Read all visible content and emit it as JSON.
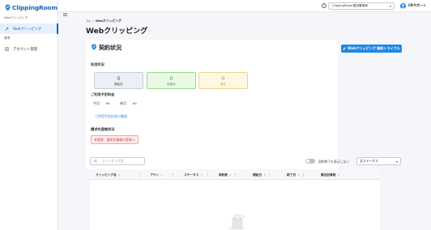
{
  "brand": {
    "name": "ClippingRoom",
    "color": "#1565c0"
  },
  "sidebar": {
    "section1": "Webクリッピング",
    "item_clipping": "Webクリッピング",
    "section2": "管理",
    "item_account": "アカウント管理"
  },
  "header": {
    "company": "ClippingRoom運用事務局",
    "user": "CRサポート",
    "help_icon": "?"
  },
  "breadcrumb": {
    "top": "Top",
    "sep": "/",
    "current": "Webクリッピング"
  },
  "page_title": "Webクリッピング",
  "contract": {
    "title": "契約状況",
    "trial_button": "Webクリッピング 無料トライアル",
    "usage_label": "利用状況",
    "statuses": [
      {
        "count": "0",
        "label": "開始前",
        "color": "#555555"
      },
      {
        "count": "0",
        "label": "利用中",
        "color": "#3a9c2a"
      },
      {
        "count": "0",
        "label": "停止",
        "color": "#c29311"
      }
    ],
    "fee_label": "ご利用予定料金",
    "this_month_label": "今月：",
    "this_month_value": "¥0",
    "next_month_label": "来月：",
    "next_month_value": "¥0",
    "fee_link": "ご利用予定料金の確認",
    "billing_label": "請求先登録状況",
    "billing_status": "未登録",
    "billing_link": "請求先情報の登録へ"
  },
  "filters": {
    "search_placeholder": "クリッピング名",
    "show_ended_label": "契約終了を表示しない",
    "status_select": "全ステータス"
  },
  "table": {
    "columns": [
      "クリッピング名",
      "プラン",
      "ステータス",
      "契約数",
      "開始日",
      "終了日",
      "最近記事数"
    ]
  }
}
